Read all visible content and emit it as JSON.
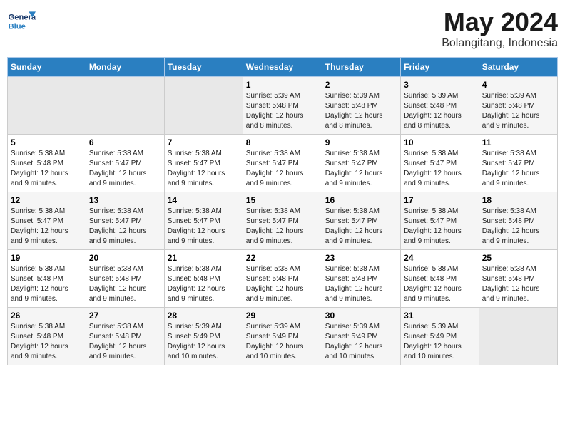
{
  "logo": {
    "line1": "General",
    "line2": "Blue"
  },
  "title": {
    "month_year": "May 2024",
    "location": "Bolangitang, Indonesia"
  },
  "headers": [
    "Sunday",
    "Monday",
    "Tuesday",
    "Wednesday",
    "Thursday",
    "Friday",
    "Saturday"
  ],
  "weeks": [
    [
      {
        "num": "",
        "info": ""
      },
      {
        "num": "",
        "info": ""
      },
      {
        "num": "",
        "info": ""
      },
      {
        "num": "1",
        "info": "Sunrise: 5:39 AM\nSunset: 5:48 PM\nDaylight: 12 hours\nand 8 minutes."
      },
      {
        "num": "2",
        "info": "Sunrise: 5:39 AM\nSunset: 5:48 PM\nDaylight: 12 hours\nand 8 minutes."
      },
      {
        "num": "3",
        "info": "Sunrise: 5:39 AM\nSunset: 5:48 PM\nDaylight: 12 hours\nand 8 minutes."
      },
      {
        "num": "4",
        "info": "Sunrise: 5:39 AM\nSunset: 5:48 PM\nDaylight: 12 hours\nand 9 minutes."
      }
    ],
    [
      {
        "num": "5",
        "info": "Sunrise: 5:38 AM\nSunset: 5:48 PM\nDaylight: 12 hours\nand 9 minutes."
      },
      {
        "num": "6",
        "info": "Sunrise: 5:38 AM\nSunset: 5:47 PM\nDaylight: 12 hours\nand 9 minutes."
      },
      {
        "num": "7",
        "info": "Sunrise: 5:38 AM\nSunset: 5:47 PM\nDaylight: 12 hours\nand 9 minutes."
      },
      {
        "num": "8",
        "info": "Sunrise: 5:38 AM\nSunset: 5:47 PM\nDaylight: 12 hours\nand 9 minutes."
      },
      {
        "num": "9",
        "info": "Sunrise: 5:38 AM\nSunset: 5:47 PM\nDaylight: 12 hours\nand 9 minutes."
      },
      {
        "num": "10",
        "info": "Sunrise: 5:38 AM\nSunset: 5:47 PM\nDaylight: 12 hours\nand 9 minutes."
      },
      {
        "num": "11",
        "info": "Sunrise: 5:38 AM\nSunset: 5:47 PM\nDaylight: 12 hours\nand 9 minutes."
      }
    ],
    [
      {
        "num": "12",
        "info": "Sunrise: 5:38 AM\nSunset: 5:47 PM\nDaylight: 12 hours\nand 9 minutes."
      },
      {
        "num": "13",
        "info": "Sunrise: 5:38 AM\nSunset: 5:47 PM\nDaylight: 12 hours\nand 9 minutes."
      },
      {
        "num": "14",
        "info": "Sunrise: 5:38 AM\nSunset: 5:47 PM\nDaylight: 12 hours\nand 9 minutes."
      },
      {
        "num": "15",
        "info": "Sunrise: 5:38 AM\nSunset: 5:47 PM\nDaylight: 12 hours\nand 9 minutes."
      },
      {
        "num": "16",
        "info": "Sunrise: 5:38 AM\nSunset: 5:47 PM\nDaylight: 12 hours\nand 9 minutes."
      },
      {
        "num": "17",
        "info": "Sunrise: 5:38 AM\nSunset: 5:47 PM\nDaylight: 12 hours\nand 9 minutes."
      },
      {
        "num": "18",
        "info": "Sunrise: 5:38 AM\nSunset: 5:48 PM\nDaylight: 12 hours\nand 9 minutes."
      }
    ],
    [
      {
        "num": "19",
        "info": "Sunrise: 5:38 AM\nSunset: 5:48 PM\nDaylight: 12 hours\nand 9 minutes."
      },
      {
        "num": "20",
        "info": "Sunrise: 5:38 AM\nSunset: 5:48 PM\nDaylight: 12 hours\nand 9 minutes."
      },
      {
        "num": "21",
        "info": "Sunrise: 5:38 AM\nSunset: 5:48 PM\nDaylight: 12 hours\nand 9 minutes."
      },
      {
        "num": "22",
        "info": "Sunrise: 5:38 AM\nSunset: 5:48 PM\nDaylight: 12 hours\nand 9 minutes."
      },
      {
        "num": "23",
        "info": "Sunrise: 5:38 AM\nSunset: 5:48 PM\nDaylight: 12 hours\nand 9 minutes."
      },
      {
        "num": "24",
        "info": "Sunrise: 5:38 AM\nSunset: 5:48 PM\nDaylight: 12 hours\nand 9 minutes."
      },
      {
        "num": "25",
        "info": "Sunrise: 5:38 AM\nSunset: 5:48 PM\nDaylight: 12 hours\nand 9 minutes."
      }
    ],
    [
      {
        "num": "26",
        "info": "Sunrise: 5:38 AM\nSunset: 5:48 PM\nDaylight: 12 hours\nand 9 minutes."
      },
      {
        "num": "27",
        "info": "Sunrise: 5:38 AM\nSunset: 5:48 PM\nDaylight: 12 hours\nand 9 minutes."
      },
      {
        "num": "28",
        "info": "Sunrise: 5:39 AM\nSunset: 5:49 PM\nDaylight: 12 hours\nand 10 minutes."
      },
      {
        "num": "29",
        "info": "Sunrise: 5:39 AM\nSunset: 5:49 PM\nDaylight: 12 hours\nand 10 minutes."
      },
      {
        "num": "30",
        "info": "Sunrise: 5:39 AM\nSunset: 5:49 PM\nDaylight: 12 hours\nand 10 minutes."
      },
      {
        "num": "31",
        "info": "Sunrise: 5:39 AM\nSunset: 5:49 PM\nDaylight: 12 hours\nand 10 minutes."
      },
      {
        "num": "",
        "info": ""
      }
    ]
  ]
}
